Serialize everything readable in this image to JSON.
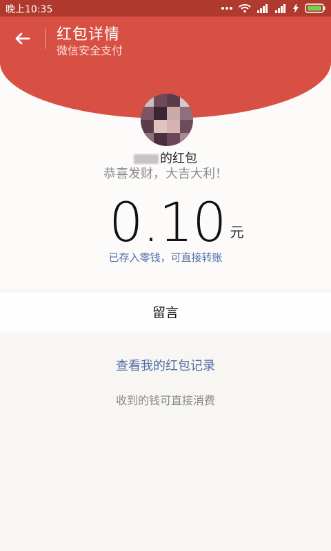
{
  "status_bar": {
    "time": "晚上10:35"
  },
  "header": {
    "title": "红包详情",
    "subtitle": "微信安全支付",
    "back_icon": "arrow-left-icon"
  },
  "card": {
    "sender_suffix": "的红包",
    "greeting": "恭喜发财，大吉大利！",
    "amount": "0.10",
    "unit": "元",
    "deposit_note": "已存入零钱，可直接转账"
  },
  "actions": {
    "message_label": "留言",
    "records_link": "查看我的红包记录",
    "footer_note": "收到的钱可直接消费"
  },
  "colors": {
    "header_red": "#d84f44",
    "status_red": "#b13a2e",
    "link_blue": "#4d6aa3"
  }
}
